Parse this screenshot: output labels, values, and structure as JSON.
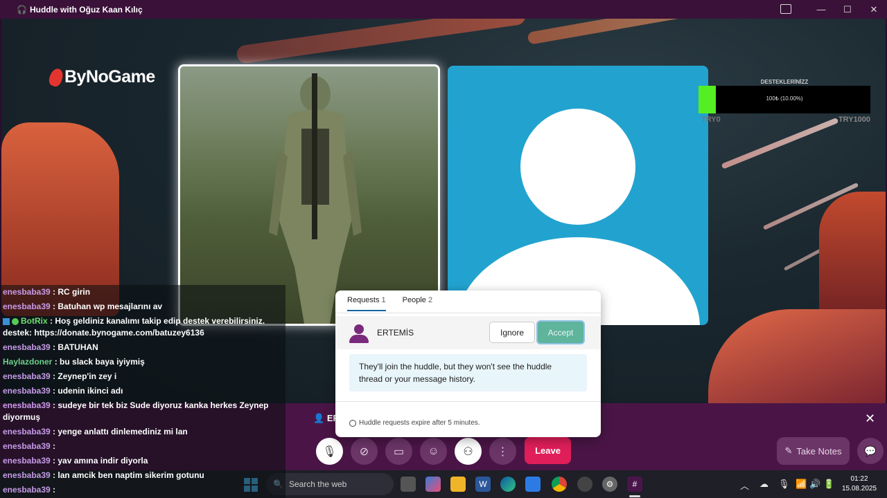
{
  "window": {
    "title": "Huddle with Oğuz Kaan Kılıç",
    "controls": [
      "picture-in-picture",
      "minimize",
      "maximize",
      "close"
    ]
  },
  "stream": {
    "logo_text": "ByNoGame",
    "donation": {
      "label": "DESTEKLERİNİZZ",
      "progress_text": "100₺ (10.00%)",
      "progress_fraction": 0.1,
      "min_label": "TRY0",
      "max_label": "TRY1000"
    }
  },
  "chat": [
    {
      "user": "enesbaba39",
      "text": " : RC girin"
    },
    {
      "user": "enesbaba39",
      "text": " : Batuhan wp mesajlarını av"
    },
    {
      "user": "BotRix",
      "text": " : Hoş geldiniz kanalımı takip edip destek verebilirsiniz. destek: https://donate.bynogame.com/batuzey6136",
      "bot": true
    },
    {
      "user": "enesbaba39",
      "text": " : BATUHAN"
    },
    {
      "user": "Haylazdoner",
      "text": " : bu slack baya iyiymiş",
      "green": true
    },
    {
      "user": "enesbaba39",
      "text": " : Zeynep'in zey i"
    },
    {
      "user": "enesbaba39",
      "text": " : udenin ikinci adı"
    },
    {
      "user": "enesbaba39",
      "text": " : sudeye bir tek biz Sude diyoruz kanka herkes Zeynep diyormuş"
    },
    {
      "user": "enesbaba39",
      "text": " : yenge anlattı dinlemediniz mi lan"
    },
    {
      "user": "enesbaba39",
      "text": " : "
    },
    {
      "user": "enesbaba39",
      "text": " : yav amına indir diyorla"
    },
    {
      "user": "enesbaba39",
      "text": " : lan amcik ben naptim sikerim gotunu"
    },
    {
      "user": "enesbaba39",
      "text": " : "
    }
  ],
  "request_popup": {
    "tabs": [
      {
        "label": "Requests",
        "count": "1"
      },
      {
        "label": "People",
        "count": "2"
      }
    ],
    "requester": "ERTEMİS",
    "ignore_label": "Ignore",
    "accept_label": "Accept",
    "info_text": "They'll join the huddle, but they won't see the huddle thread or your message history.",
    "footer_text": "Huddle requests expire after 5 minutes."
  },
  "huddle_bar": {
    "participant_initials": "ER",
    "leave_label": "Leave",
    "take_notes_label": "Take Notes",
    "controls": [
      "mic-icon",
      "camera-off-icon",
      "screen-share-icon",
      "emoji-icon",
      "invite-icon",
      "more-icon"
    ]
  },
  "taskbar": {
    "search_placeholder": "Search the web",
    "time": "01:22",
    "date": "15.08.2025"
  },
  "colors": {
    "huddle_bg": "#4a1546",
    "leave_red": "#e01e5a",
    "accept_green": "#5fb49c",
    "avatar_blue": "#22a3cf"
  }
}
